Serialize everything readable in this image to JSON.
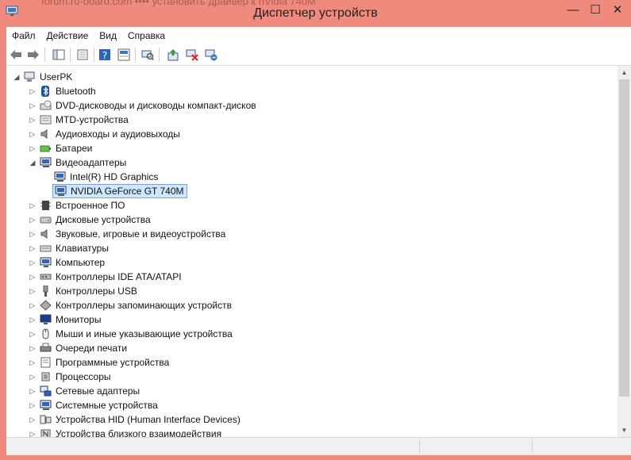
{
  "window": {
    "title": "Диспетчер устройств",
    "background_bleed_text": "forum.ru-board.com  ••••  установить драйвер к nVidia 740M",
    "minimize_glyph": "—",
    "maximize_glyph": "☐",
    "close_glyph": "✕"
  },
  "menu": [
    "Файл",
    "Действие",
    "Вид",
    "Справка"
  ],
  "toolbar": [
    "back-icon",
    "forward-icon",
    "properties-panel-icon",
    "refresh-icon",
    "help-icon",
    "device-properties-icon",
    "scan-hardware-icon",
    "update-driver-icon",
    "disable-device-icon",
    "uninstall-device-icon"
  ],
  "tree": {
    "root": "UserPK",
    "items": [
      {
        "label": "Bluetooth",
        "icon": "bluetooth-icon",
        "expanded": false
      },
      {
        "label": "DVD-дисководы и дисководы компакт-дисков",
        "icon": "dvd-drive-icon",
        "expanded": false
      },
      {
        "label": "MTD-устройства",
        "icon": "mtd-device-icon",
        "expanded": false
      },
      {
        "label": "Аудиовходы и аудиовыходы",
        "icon": "speaker-icon",
        "expanded": false
      },
      {
        "label": "Батареи",
        "icon": "battery-icon",
        "expanded": false
      },
      {
        "label": "Видеоадаптеры",
        "icon": "display-adapter-icon",
        "expanded": true,
        "children": [
          {
            "label": "Intel(R) HD Graphics",
            "icon": "display-adapter-icon",
            "selected": false
          },
          {
            "label": "NVIDIA GeForce GT 740M",
            "icon": "display-adapter-icon",
            "selected": true
          }
        ]
      },
      {
        "label": "Встроенное ПО",
        "icon": "firmware-icon",
        "expanded": false
      },
      {
        "label": "Дисковые устройства",
        "icon": "disk-drive-icon",
        "expanded": false
      },
      {
        "label": "Звуковые, игровые и видеоустройства",
        "icon": "speaker-icon",
        "expanded": false
      },
      {
        "label": "Клавиатуры",
        "icon": "keyboard-icon",
        "expanded": false
      },
      {
        "label": "Компьютер",
        "icon": "computer-icon",
        "expanded": false
      },
      {
        "label": "Контроллеры IDE ATA/ATAPI",
        "icon": "ide-controller-icon",
        "expanded": false
      },
      {
        "label": "Контроллеры USB",
        "icon": "usb-icon",
        "expanded": false
      },
      {
        "label": "Контроллеры запоминающих устройств",
        "icon": "storage-controller-icon",
        "expanded": false
      },
      {
        "label": "Мониторы",
        "icon": "monitor-icon",
        "expanded": false
      },
      {
        "label": "Мыши и иные указывающие устройства",
        "icon": "mouse-icon",
        "expanded": false
      },
      {
        "label": "Очереди печати",
        "icon": "printer-icon",
        "expanded": false
      },
      {
        "label": "Программные устройства",
        "icon": "software-device-icon",
        "expanded": false
      },
      {
        "label": "Процессоры",
        "icon": "processor-icon",
        "expanded": false
      },
      {
        "label": "Сетевые адаптеры",
        "icon": "network-adapter-icon",
        "expanded": false
      },
      {
        "label": "Системные устройства",
        "icon": "system-device-icon",
        "expanded": false
      },
      {
        "label": "Устройства HID (Human Interface Devices)",
        "icon": "hid-icon",
        "expanded": false
      },
      {
        "label": "Устройства близкого взаимодействия",
        "icon": "nfc-icon",
        "expanded": false
      }
    ]
  },
  "colors": {
    "window_frame": "#f08a7c",
    "selection_fill": "#cce8ff",
    "selection_border": "#7da2ce"
  }
}
